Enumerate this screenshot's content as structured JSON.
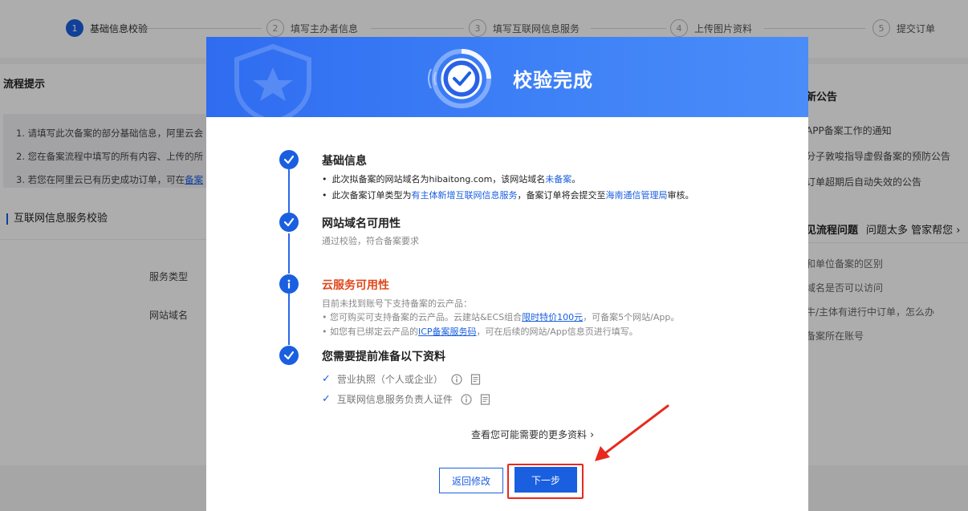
{
  "steps": [
    {
      "num": "1",
      "label": "基础信息校验"
    },
    {
      "num": "2",
      "label": "填写主办者信息"
    },
    {
      "num": "3",
      "label": "填写互联网信息服务"
    },
    {
      "num": "4",
      "label": "上传图片资料"
    },
    {
      "num": "5",
      "label": "提交订单"
    }
  ],
  "left_panel": {
    "title": "流程提示",
    "tips": [
      "1. 请填写此次备案的部分基础信息，阿里云会",
      "2. 您在备案流程中填写的所有内容、上传的所",
      "3. 若您在阿里云已有历史成功订单，可在"
    ],
    "tip_link": "备案",
    "section": "互联网信息服务校验",
    "labels": [
      "服务类型",
      "网站域名"
    ]
  },
  "right_panel": {
    "title": "新公告",
    "notices": [
      "APP备案工作的通知",
      "分子敦唆指导虚假备案的预防公告",
      "订单超期后自动失效的公告"
    ],
    "faq_title": "见流程问题",
    "faq_link": "问题太多 管家帮您",
    "faqs": [
      "和单位备案的区别",
      "域名是否可以访问",
      "牛/主体有进行中订单，怎么办",
      "备案所在账号"
    ]
  },
  "modal": {
    "title": "校验完成",
    "sections": {
      "basic": {
        "title": "基础信息",
        "line1_prefix": "此次拟备案的网站域名为hibaitong.com，该网站域名",
        "line1_link": "未备案",
        "line1_suffix": "。",
        "line2_prefix": "此次备案订单类型为",
        "line2_link1": "有主体新增互联网信息服务",
        "line2_mid": "，备案订单将会提交至",
        "line2_link2": "海南通信管理局",
        "line2_suffix": "审核。"
      },
      "domain": {
        "title": "网站域名可用性",
        "desc": "通过校验，符合备案要求"
      },
      "cloud": {
        "title": "云服务可用性",
        "desc1": "目前未找到账号下支持备案的云产品：",
        "desc2_prefix": "• 您可购买可支持备案的云产品。云建站&ECS组合",
        "desc2_link": "限时特价100元",
        "desc2_suffix": "，可备案5个网站/App。",
        "desc3_prefix": "• 如您有已绑定云产品的",
        "desc3_link": "ICP备案服务码",
        "desc3_suffix": "，可在后续的网站/App信息页进行填写。"
      },
      "materials": {
        "title": "您需要提前准备以下资料",
        "items": [
          "营业执照（个人或企业）",
          "互联网信息服务负责人证件"
        ]
      }
    },
    "more_link": "查看您可能需要的更多资料",
    "back_button": "返回修改",
    "next_button": "下一步"
  },
  "colors": {
    "primary": "#1a5fe0",
    "warning": "#e0471b",
    "highlight": "#e8291d"
  }
}
